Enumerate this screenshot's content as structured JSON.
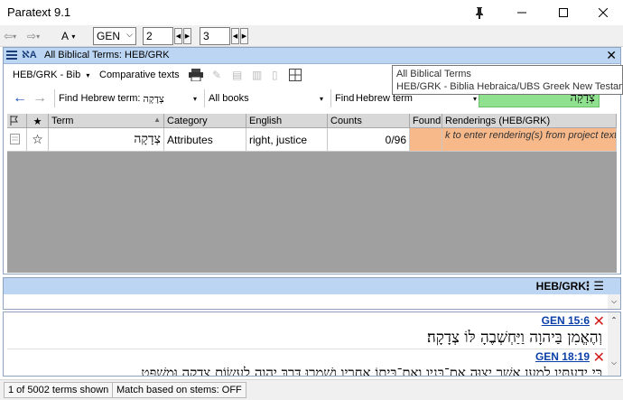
{
  "window": {
    "title": "Paratext 9.1"
  },
  "toolbar": {
    "font_menu": "A",
    "book": "GEN",
    "chapter": "2",
    "verse": "3"
  },
  "panel": {
    "title": "All Biblical Terms: HEB/GRK",
    "project_select": "HEB/GRK - Bib",
    "comparative_texts": "Comparative texts",
    "find_hebrew_label": "Find Hebrew term:",
    "find_hebrew_value": "צְדָקָה",
    "books_filter": "All books",
    "find_label": "Find",
    "find_mode": "Hebrew term",
    "search_term": "צְדָקָה"
  },
  "tooltip": {
    "line1": "All Biblical Terms",
    "line2": "HEB/GRK - Biblia Hebraica/UBS Greek New Testament"
  },
  "grid": {
    "columns": [
      "Term",
      "Category",
      "English",
      "Counts",
      "Found",
      "Renderings (HEB/GRK)"
    ],
    "row": {
      "term": "צְדָקָה",
      "category": "Attributes",
      "english": "right, justice",
      "counts": "0/96",
      "found": "",
      "renderings": "k to enter rendering(s) from project text"
    }
  },
  "panel2": {
    "title": "HEB/GRK"
  },
  "references": [
    {
      "ref": "GEN 15:6",
      "text": "וְהֶאֱמִן בַּיהוָה וַיַּחְשְׁבֶהָ לּוֹ צְדָקָה׃"
    },
    {
      "ref": "GEN 18:19",
      "text": "כִּי יְדַעְתִּיו לְמַעַן אֲשֶׁר יְצַוֶּה אֶת־בָּנָיו וְאֶת־בֵּיתוֹ אַחֲרָיו וְשָׁמְרוּ דֶּרֶךְ יְהוָה לַעֲשׂוֹת צְדָקָה וּמִשְׁפָּט"
    }
  ],
  "status": {
    "terms_shown": "1 of 5002 terms shown",
    "match_mode": "Match based on stems: OFF"
  },
  "colors": {
    "panel_header": "#bcd5f2",
    "grid_background": "#a0a0a0",
    "found_cell": "#f7b98a",
    "search_highlight": "#8fe08f",
    "link": "#0b3fa8",
    "error": "#d21c1c"
  }
}
